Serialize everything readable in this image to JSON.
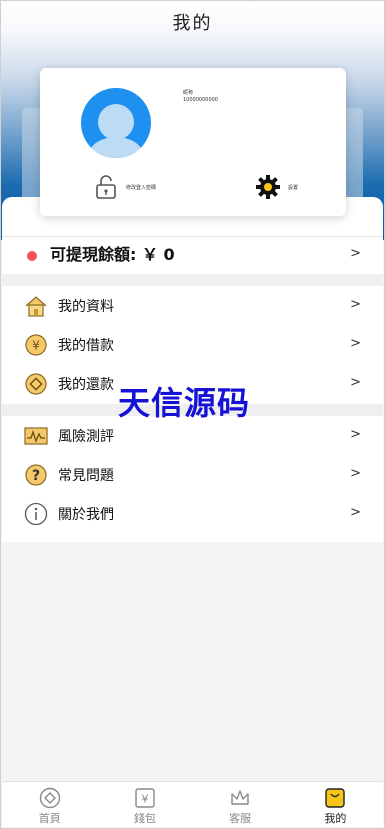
{
  "header": {
    "title": "我的"
  },
  "profile": {
    "nickname": "昵称",
    "phone": "10000000000",
    "password_label": "修改登入密碼",
    "settings_label": "設置"
  },
  "balance": {
    "text": "可提現餘額: ￥ 0",
    "indicator_color": "#f5505c"
  },
  "menu_group1": [
    {
      "label": "我的資料",
      "icon": "home-icon"
    },
    {
      "label": "我的借款",
      "icon": "yen-coin-icon"
    },
    {
      "label": "我的還款",
      "icon": "coin-icon"
    }
  ],
  "menu_group2": [
    {
      "label": "風險測評",
      "icon": "risk-chart-icon"
    },
    {
      "label": "常見問題",
      "icon": "question-icon"
    },
    {
      "label": "關於我們",
      "icon": "info-icon"
    }
  ],
  "watermark": "天信源码",
  "tabs": [
    {
      "label": "首頁",
      "icon": "home-tab-icon"
    },
    {
      "label": "錢包",
      "icon": "wallet-icon"
    },
    {
      "label": "客服",
      "icon": "crown-icon"
    },
    {
      "label": "我的",
      "icon": "profile-icon",
      "active": true
    }
  ],
  "colors": {
    "accent": "#1e90f0",
    "brand_blue": "#0d5d9f",
    "gold": "#f0b43c"
  }
}
